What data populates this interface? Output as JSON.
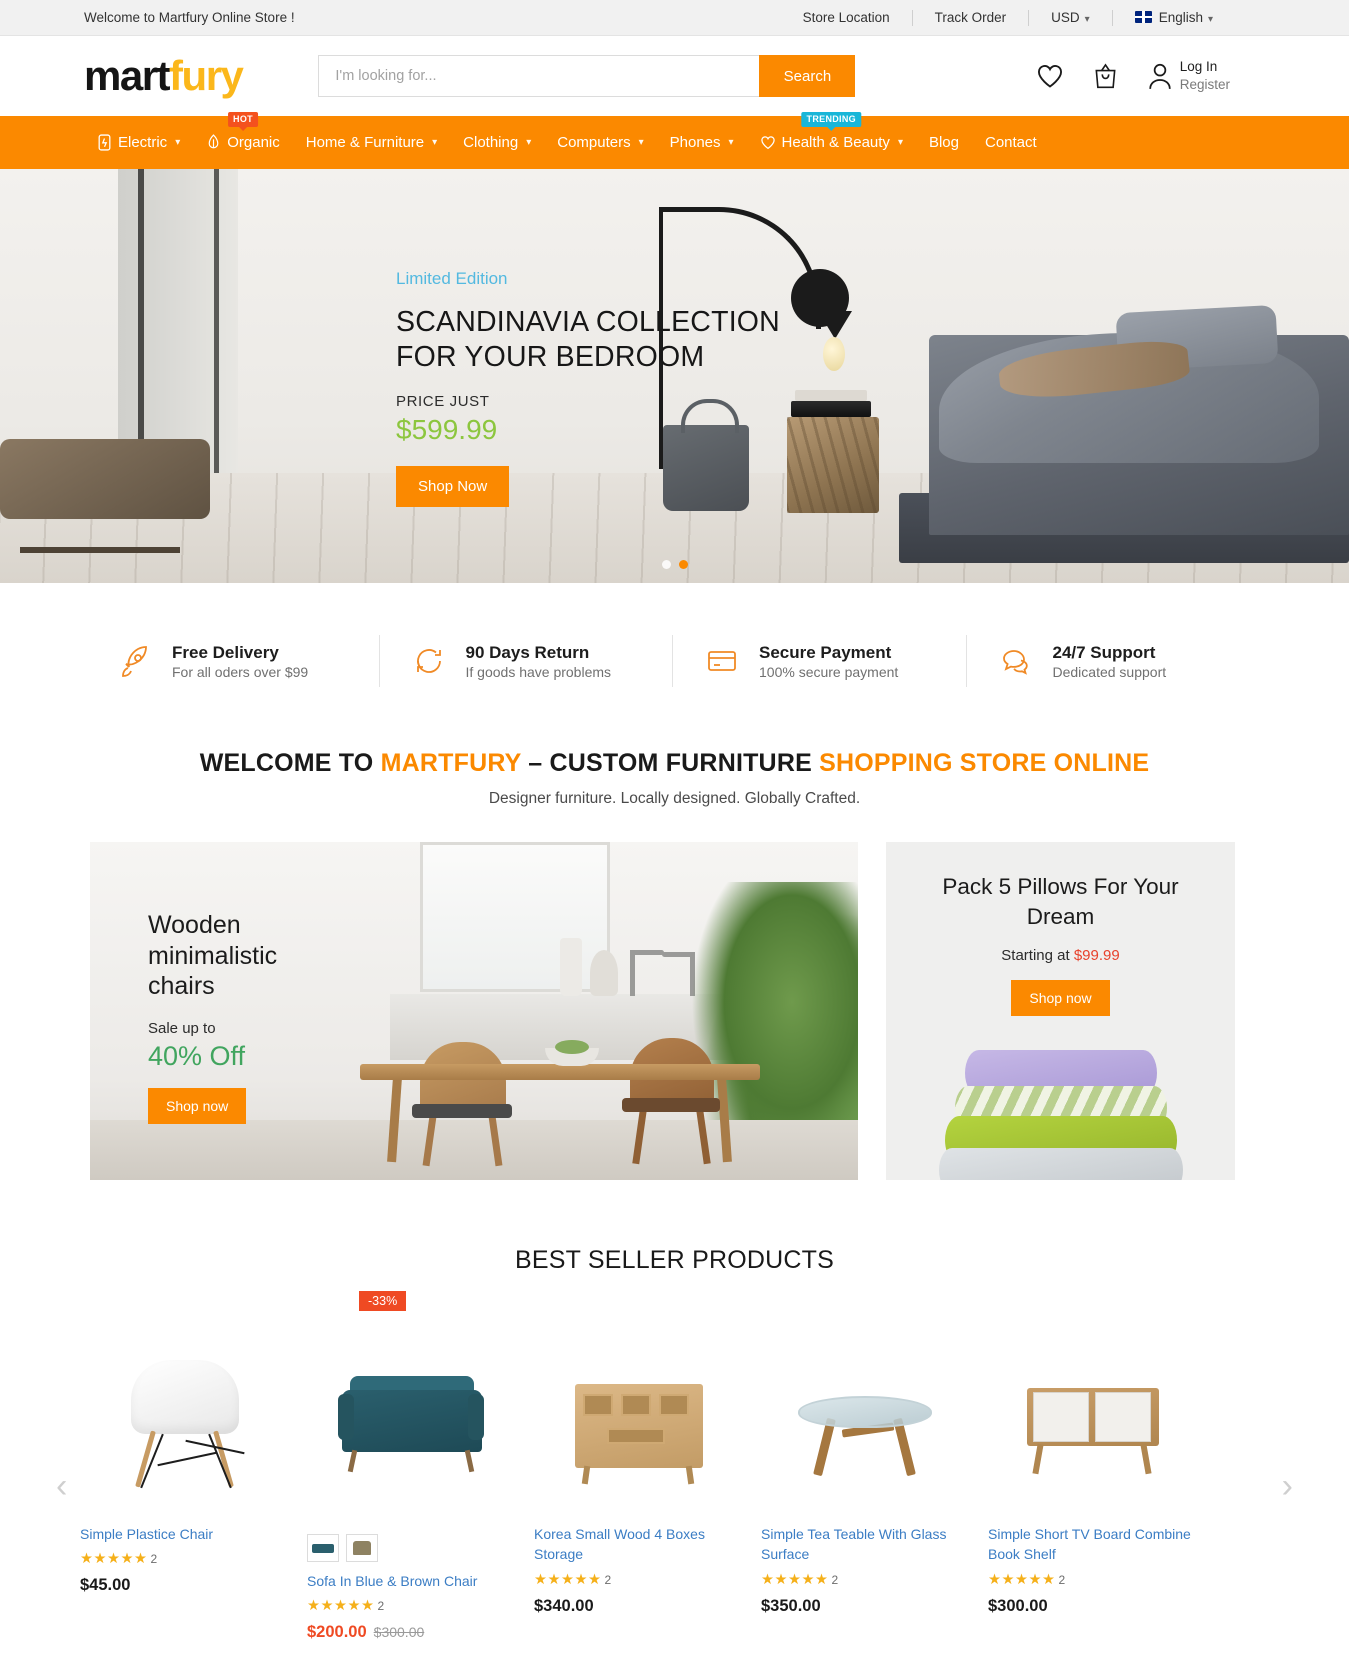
{
  "topbar": {
    "welcome": "Welcome to Martfury Online Store !",
    "store_location": "Store Location",
    "track_order": "Track Order",
    "currency": "USD",
    "language": "English"
  },
  "header": {
    "logo_mart": "mart",
    "logo_fury": "fury",
    "search_placeholder": "I'm looking for...",
    "search_value": "",
    "search_button": "Search",
    "login": "Log In",
    "register": "Register"
  },
  "nav": {
    "items": [
      {
        "label": "Electric",
        "icon": "electric-icon",
        "caret": true,
        "badge": ""
      },
      {
        "label": "Organic",
        "icon": "organic-icon",
        "caret": false,
        "badge": "HOT"
      },
      {
        "label": "Home & Furniture",
        "icon": "",
        "caret": true,
        "badge": ""
      },
      {
        "label": "Clothing",
        "icon": "",
        "caret": true,
        "badge": ""
      },
      {
        "label": "Computers",
        "icon": "",
        "caret": true,
        "badge": ""
      },
      {
        "label": "Phones",
        "icon": "",
        "caret": true,
        "badge": ""
      },
      {
        "label": "Health & Beauty",
        "icon": "health-icon",
        "caret": true,
        "badge": "TRENDING"
      },
      {
        "label": "Blog",
        "icon": "",
        "caret": false,
        "badge": ""
      },
      {
        "label": "Contact",
        "icon": "",
        "caret": false,
        "badge": ""
      }
    ]
  },
  "hero": {
    "eyebrow": "Limited Edition",
    "title_line1": "SCANDINAVIA COLLECTION",
    "title_line2": "FOR YOUR BEDROOM",
    "price_label": "PRICE JUST",
    "price": "$599.99",
    "cta": "Shop Now",
    "slides": 2,
    "active_slide": 1
  },
  "features": [
    {
      "title": "Free Delivery",
      "subtitle": "For all oders over $99",
      "icon": "rocket-icon"
    },
    {
      "title": "90 Days Return",
      "subtitle": "If goods have problems",
      "icon": "refresh-icon"
    },
    {
      "title": "Secure Payment",
      "subtitle": "100% secure payment",
      "icon": "credit-card-icon"
    },
    {
      "title": "24/7 Support",
      "subtitle": "Dedicated support",
      "icon": "chat-icon"
    }
  ],
  "welcome_section": {
    "part1": "WELCOME TO ",
    "brand": "MARTFURY",
    "part2": " – CUSTOM FURNITURE ",
    "part3": "SHOPPING STORE ONLINE",
    "subtitle": "Designer furniture. Locally designed. Globally Crafted."
  },
  "promo_left": {
    "title_line1": "Wooden",
    "title_line2": "minimalistic",
    "title_line3": "chairs",
    "sale_label": "Sale up to",
    "discount": "40% Off",
    "cta": "Shop now"
  },
  "promo_right": {
    "title_line1": "Pack 5 Pillows For Your",
    "title_line2": "Dream",
    "starting_label": "Starting at ",
    "starting_price": "$99.99",
    "cta": "Shop now"
  },
  "best_seller": {
    "heading": "BEST SELLER PRODUCTS",
    "prev": "‹",
    "next": "›",
    "products": [
      {
        "name": "Simple Plastice Chair",
        "rating": "★★★★★",
        "review_count": "2",
        "price": "$45.00",
        "old_price": "",
        "badge": "",
        "swatches": []
      },
      {
        "name": "Sofa In Blue & Brown Chair",
        "rating": "★★★★★",
        "review_count": "2",
        "price": "$200.00",
        "old_price": "$300.00",
        "badge": "-33%",
        "swatches": [
          "blue-sofa-swatch",
          "brown-chair-swatch"
        ]
      },
      {
        "name": "Korea Small Wood 4 Boxes Storage",
        "rating": "★★★★★",
        "review_count": "2",
        "price": "$340.00",
        "old_price": "",
        "badge": "",
        "swatches": []
      },
      {
        "name": "Simple Tea Teable With Glass Surface",
        "rating": "★★★★★",
        "review_count": "2",
        "price": "$350.00",
        "old_price": "",
        "badge": "",
        "swatches": []
      },
      {
        "name": "Simple Short TV Board Combine Book Shelf",
        "rating": "★★★★★",
        "review_count": "2",
        "price": "$300.00",
        "old_price": "",
        "badge": "",
        "swatches": []
      }
    ]
  },
  "colors": {
    "accent": "#fb8900",
    "link": "#3b7dc4",
    "sale": "#ef4a23",
    "green": "#8cc63e",
    "promo_green": "#41a55f",
    "star": "#f5b01a",
    "eyebrow": "#53b9e0",
    "trending": "#19b6d8"
  }
}
